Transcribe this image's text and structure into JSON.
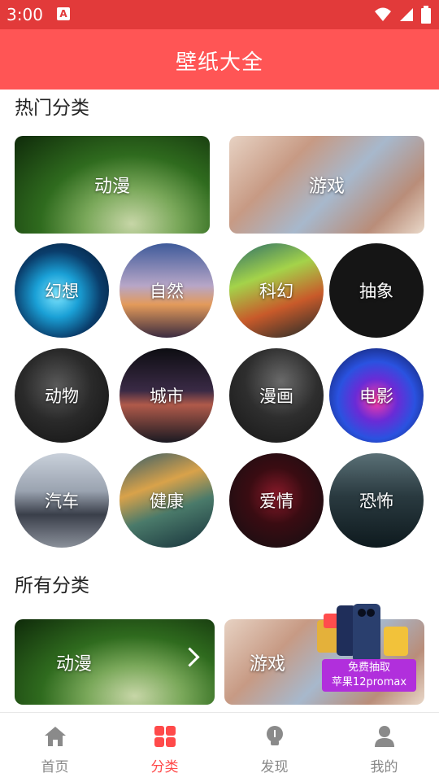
{
  "status": {
    "time": "3:00",
    "notif": "A"
  },
  "header": {
    "title": "壁纸大全"
  },
  "hot": {
    "title": "热门分类",
    "cards": [
      {
        "label": "动漫"
      },
      {
        "label": "游戏"
      }
    ],
    "circles": [
      {
        "label": "幻想"
      },
      {
        "label": "自然"
      },
      {
        "label": "科幻"
      },
      {
        "label": "抽象"
      },
      {
        "label": "动物"
      },
      {
        "label": "城市"
      },
      {
        "label": "漫画"
      },
      {
        "label": "电影"
      },
      {
        "label": "汽车"
      },
      {
        "label": "健康"
      },
      {
        "label": "爱情"
      },
      {
        "label": "恐怖"
      }
    ]
  },
  "all": {
    "title": "所有分类",
    "cards": [
      {
        "label": "动漫"
      },
      {
        "label": "游戏"
      }
    ]
  },
  "promo": {
    "line1": "免费抽取",
    "line2": "苹果12promax"
  },
  "nav": {
    "items": [
      {
        "label": "首页",
        "icon": "home-icon"
      },
      {
        "label": "分类",
        "icon": "grid-icon"
      },
      {
        "label": "发现",
        "icon": "lightbulb-icon"
      },
      {
        "label": "我的",
        "icon": "user-icon"
      }
    ],
    "active_color": "#ff4a4a",
    "inactive_color": "#888888"
  },
  "colors": {
    "header": "#ff5555",
    "statusbar": "#e23a3a"
  }
}
